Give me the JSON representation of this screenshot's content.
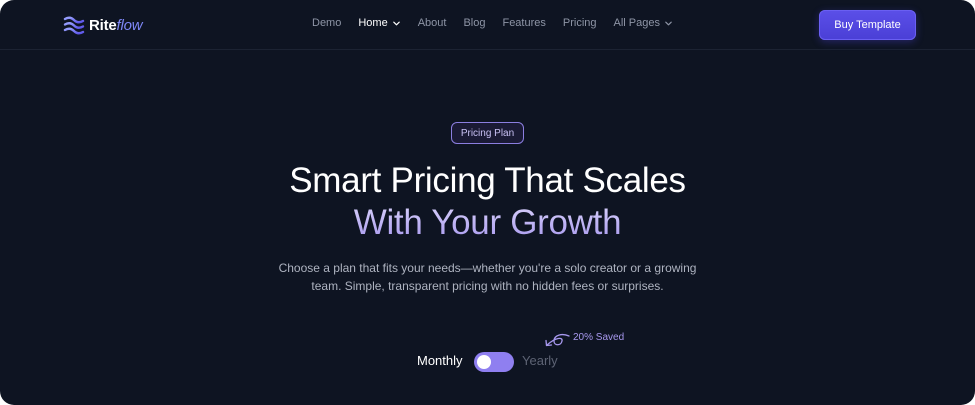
{
  "brand": {
    "name_main": "Rite",
    "name_accent": "flow",
    "icon": "waves-logo-icon",
    "accent_color": "#7d86f5"
  },
  "nav": {
    "items": [
      {
        "label": "Demo",
        "active": false,
        "dropdown": false
      },
      {
        "label": "Home",
        "active": true,
        "dropdown": true
      },
      {
        "label": "About",
        "active": false,
        "dropdown": false
      },
      {
        "label": "Blog",
        "active": false,
        "dropdown": false
      },
      {
        "label": "Features",
        "active": false,
        "dropdown": false
      },
      {
        "label": "Pricing",
        "active": false,
        "dropdown": false
      },
      {
        "label": "All Pages",
        "active": false,
        "dropdown": true
      }
    ],
    "cta_label": "Buy Template",
    "cta_color": "#5346e0"
  },
  "hero": {
    "badge": "Pricing Plan",
    "title_line1": "Smart Pricing That Scales",
    "title_line2": "With Your Growth",
    "subtitle": "Choose a plan that fits your needs—whether you're a solo creator or a growing team. Simple, transparent pricing with no hidden fees or surprises."
  },
  "billing_toggle": {
    "left_label": "Monthly",
    "right_label": "Yearly",
    "selected": "Monthly",
    "savings_note": "20% Saved",
    "toggle_color": "#8f7ff0"
  },
  "colors": {
    "background": "#0e1422",
    "heading_gradient": "#b9aef2"
  }
}
